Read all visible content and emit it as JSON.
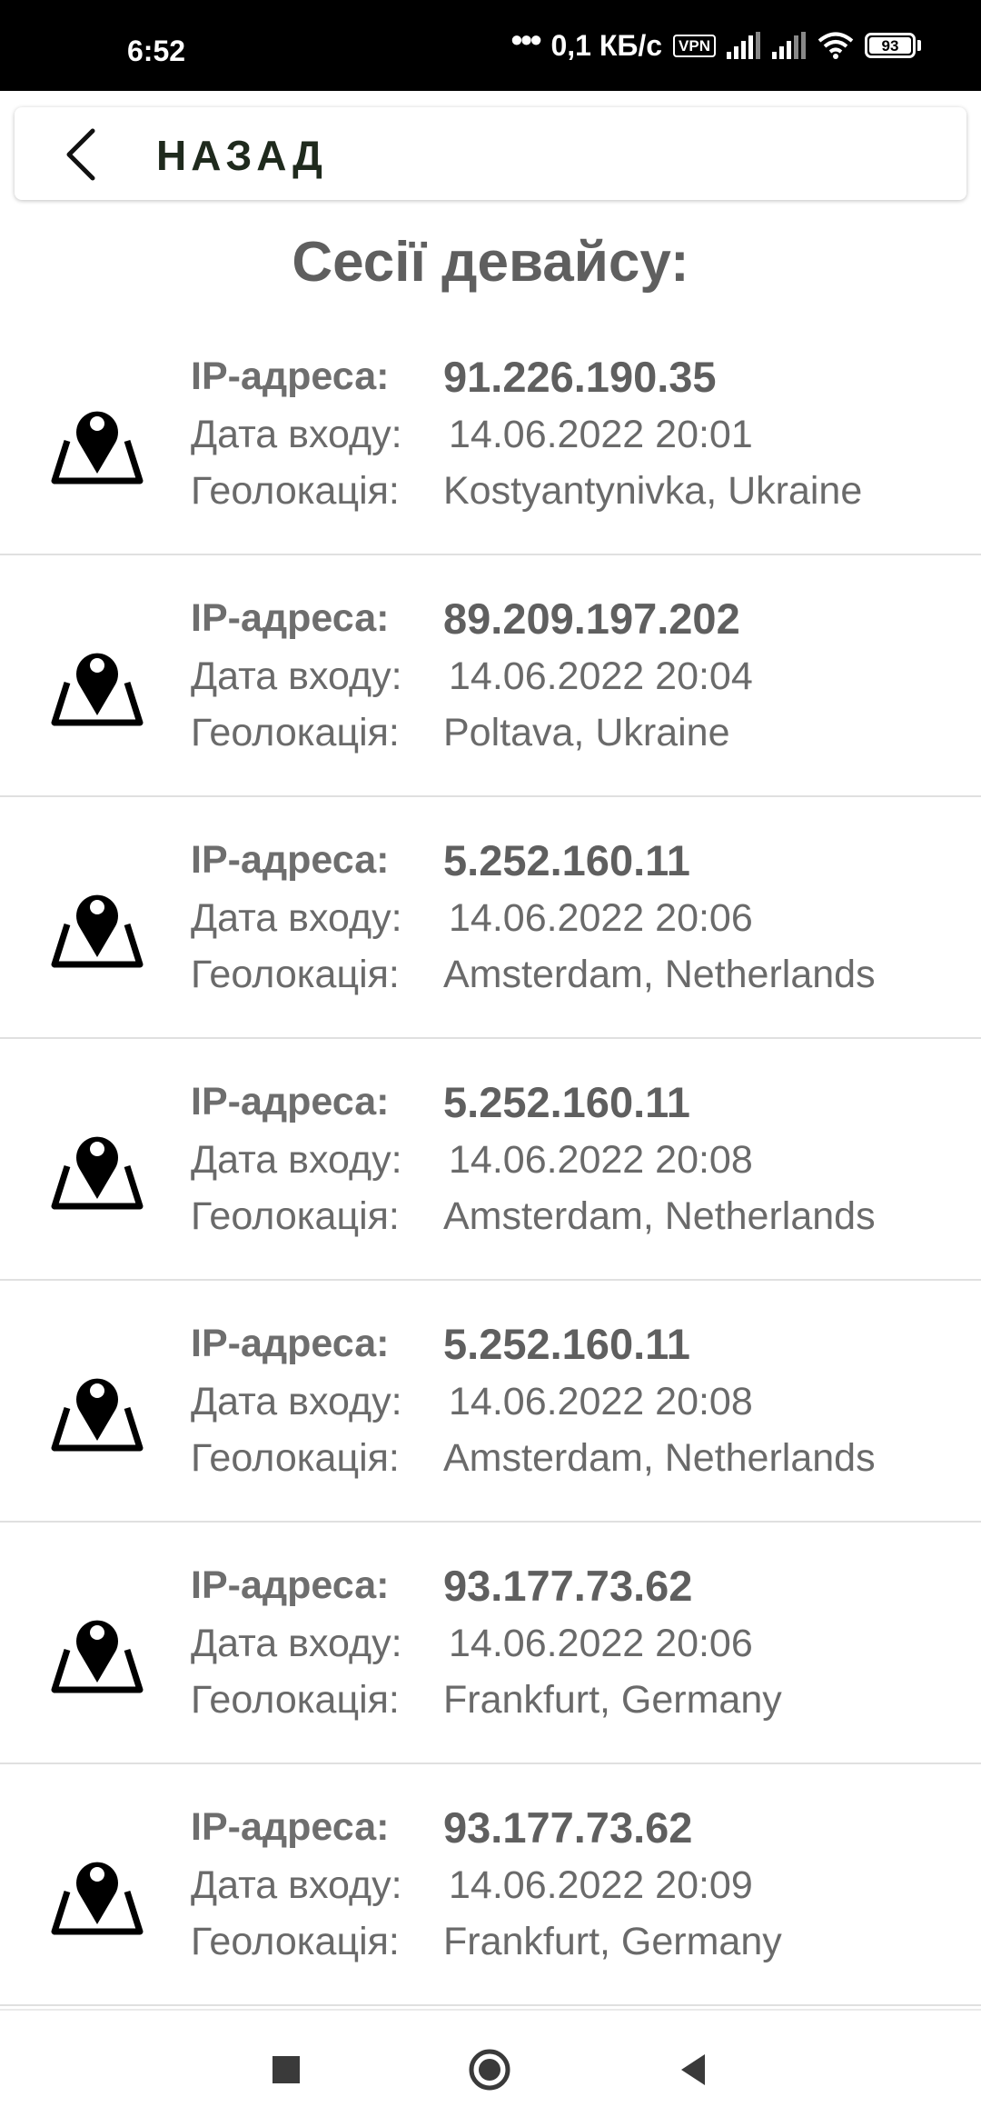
{
  "status_bar": {
    "time": "6:52",
    "dots": "•••",
    "speed": "0,1 КБ/с",
    "vpn": "VPN",
    "battery": "93"
  },
  "header": {
    "back_label": "НАЗАД"
  },
  "page": {
    "title": "Сесії девайсу:"
  },
  "labels": {
    "ip": "IP-адреса:",
    "date": "Дата входу:",
    "geo": "Геолокація:"
  },
  "sessions": [
    {
      "ip": "91.226.190.35",
      "date": "14.06.2022 20:01",
      "geo": "Kostyantynivka, Ukraine"
    },
    {
      "ip": "89.209.197.202",
      "date": "14.06.2022 20:04",
      "geo": "Poltava, Ukraine"
    },
    {
      "ip": "5.252.160.11",
      "date": "14.06.2022 20:06",
      "geo": "Amsterdam, Netherlands"
    },
    {
      "ip": "5.252.160.11",
      "date": "14.06.2022 20:08",
      "geo": "Amsterdam, Netherlands"
    },
    {
      "ip": "5.252.160.11",
      "date": "14.06.2022 20:08",
      "geo": "Amsterdam, Netherlands"
    },
    {
      "ip": "93.177.73.62",
      "date": "14.06.2022 20:06",
      "geo": "Frankfurt, Germany"
    },
    {
      "ip": "93.177.73.62",
      "date": "14.06.2022 20:09",
      "geo": "Frankfurt, Germany"
    }
  ],
  "icons": {
    "back": "chevron-left-icon",
    "session": "map-pin-icon",
    "nav_recents": "square-icon",
    "nav_home": "circle-icon",
    "nav_back": "triangle-left-icon"
  },
  "colors": {
    "status_bar": "#000000",
    "text_primary": "#5f5f5f",
    "header_text": "#1f2a1d",
    "divider": "#e0e0e0"
  }
}
